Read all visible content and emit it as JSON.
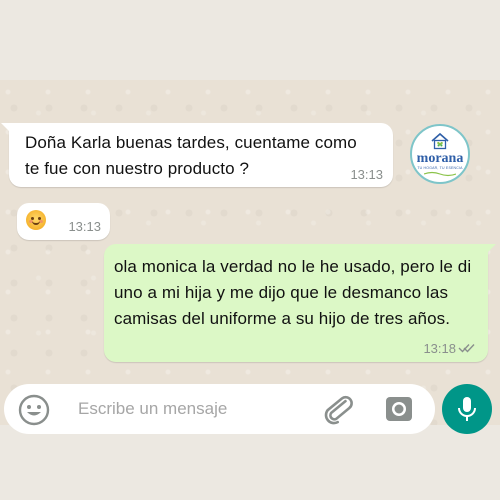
{
  "messages": [
    {
      "direction": "incoming",
      "text": "Doña Karla buenas tardes, cuentame como te fue con nuestro producto ?",
      "time": "13:13"
    },
    {
      "direction": "incoming",
      "emoji": "smiling-face",
      "time": "13:13"
    },
    {
      "direction": "outgoing",
      "text": "ola monica la verdad no le he usado, pero le di uno a mi hija y me dijo que le desmanco las camisas del uniforme a su hijo de tres años.",
      "time": "13:18",
      "status": "read-double-check"
    }
  ],
  "logo": {
    "name": "morana",
    "tagline": "TU HOGAR, TU ESENCIA"
  },
  "composer": {
    "placeholder": "Escribe un mensaje"
  },
  "colors": {
    "incoming_bubble": "#ffffff",
    "outgoing_bubble": "#dcf8c6",
    "mic_button": "#009688",
    "chat_background": "#e9e1d5"
  },
  "icons": {
    "emoji_button": "emoji-icon",
    "attach": "paperclip-icon",
    "camera": "camera-icon",
    "mic": "microphone-icon",
    "read_status": "double-check-icon"
  }
}
